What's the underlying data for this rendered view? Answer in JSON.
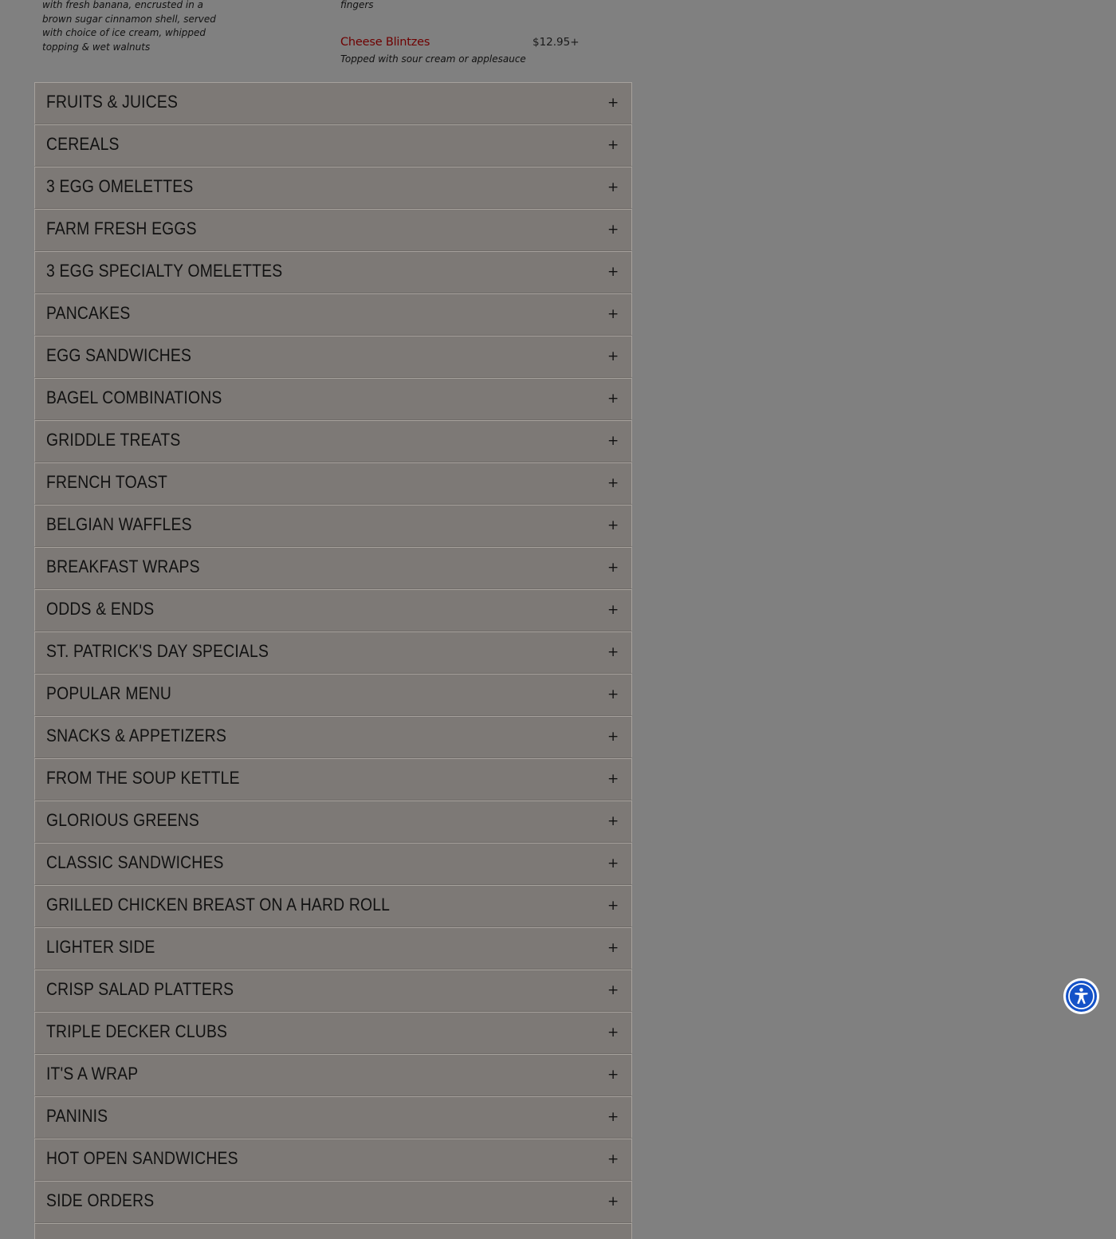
{
  "top_items": {
    "left_description": "with fresh banana, encrusted in a brown sugar cinnamon shell, served with choice of ice cream, whipped topping & wet walnuts",
    "right_description_tail": "fingers",
    "cheese_blintzes": {
      "name": "Cheese Blintzes",
      "price": "$12.95+",
      "description": "Topped with sour cream or applesauce"
    }
  },
  "menu_sections": [
    "FRUITS & JUICES",
    "CEREALS",
    "3 EGG OMELETTES",
    "FARM FRESH EGGS",
    "3 EGG SPECIALTY OMELETTES",
    "PANCAKES",
    "EGG SANDWICHES",
    "BAGEL COMBINATIONS",
    "GRIDDLE TREATS",
    "FRENCH TOAST",
    "BELGIAN WAFFLES",
    "BREAKFAST WRAPS",
    "ODDS & ENDS",
    "ST. PATRICK'S DAY SPECIALS",
    "POPULAR MENU",
    "SNACKS & APPETIZERS",
    "FROM THE SOUP KETTLE",
    "GLORIOUS GREENS",
    "CLASSIC SANDWICHES",
    "GRILLED CHICKEN BREAST ON A HARD ROLL",
    "LIGHTER SIDE",
    "CRISP SALAD PLATTERS",
    "TRIPLE DECKER CLUBS",
    "IT'S A WRAP",
    "PANINIS",
    "HOT OPEN SANDWICHES",
    "SIDE ORDERS"
  ],
  "expand_symbol": "+",
  "icons": {
    "section_toggle": "plus-icon",
    "accessibility": "accessibility-icon"
  },
  "colors": {
    "overlay_background": "#808080",
    "item_name": "#6e0000",
    "accessibility_button": "#1452c8"
  }
}
